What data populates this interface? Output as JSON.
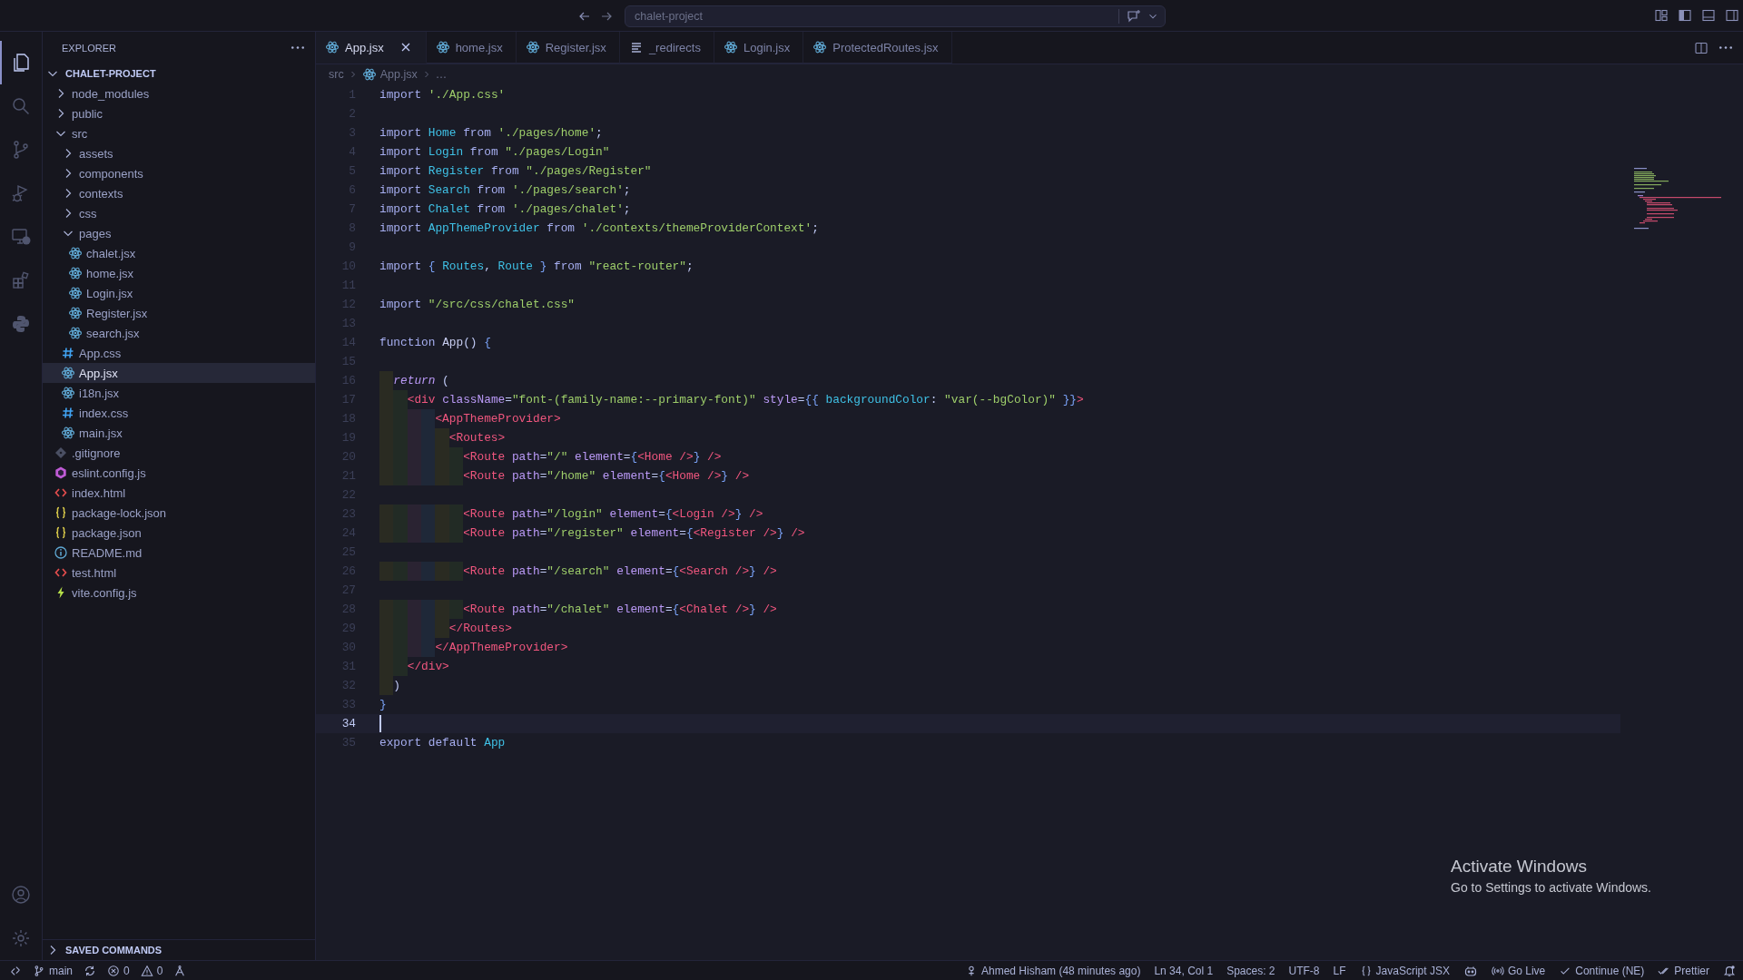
{
  "title_bar": {
    "search": "chalet-project"
  },
  "activity_bar": {
    "top": [
      {
        "kind": "files",
        "selected": true
      },
      {
        "kind": "search",
        "selected": false
      },
      {
        "kind": "source-control",
        "selected": false
      },
      {
        "kind": "run",
        "selected": false
      },
      {
        "kind": "remote",
        "selected": false
      },
      {
        "kind": "extensions",
        "selected": false
      },
      {
        "kind": "python",
        "selected": false
      }
    ],
    "bottom": [
      {
        "kind": "account"
      },
      {
        "kind": "settings"
      }
    ]
  },
  "explorer": {
    "title": "EXPLORER",
    "project": {
      "label": "CHALET-PROJECT",
      "expanded": true,
      "children": [
        {
          "label": "node_modules",
          "kind": "folder",
          "expanded": false,
          "selected": false
        },
        {
          "label": "public",
          "kind": "folder",
          "expanded": false,
          "selected": false
        },
        {
          "label": "src",
          "kind": "folder",
          "expanded": true,
          "selected": false,
          "children": [
            {
              "label": "assets",
              "kind": "folder",
              "expanded": false,
              "selected": false
            },
            {
              "label": "components",
              "kind": "folder",
              "expanded": false,
              "selected": false
            },
            {
              "label": "contexts",
              "kind": "folder",
              "expanded": false,
              "selected": false
            },
            {
              "label": "css",
              "kind": "folder",
              "expanded": false,
              "selected": false
            },
            {
              "label": "pages",
              "kind": "folder",
              "expanded": true,
              "selected": false,
              "children": [
                {
                  "label": "chalet.jsx",
                  "kind": "react",
                  "selected": false
                },
                {
                  "label": "home.jsx",
                  "kind": "react",
                  "selected": false
                },
                {
                  "label": "Login.jsx",
                  "kind": "react",
                  "selected": false
                },
                {
                  "label": "Register.jsx",
                  "kind": "react",
                  "selected": false
                },
                {
                  "label": "search.jsx",
                  "kind": "react",
                  "selected": false
                }
              ]
            },
            {
              "label": "App.css",
              "kind": "css",
              "selected": false
            },
            {
              "label": "App.jsx",
              "kind": "react",
              "selected": true
            },
            {
              "label": "i18n.jsx",
              "kind": "react",
              "selected": false
            },
            {
              "label": "index.css",
              "kind": "css",
              "selected": false
            },
            {
              "label": "main.jsx",
              "kind": "react",
              "selected": false
            }
          ]
        },
        {
          "label": ".gitignore",
          "kind": "git",
          "selected": false
        },
        {
          "label": "eslint.config.js",
          "kind": "eslint",
          "selected": false
        },
        {
          "label": "index.html",
          "kind": "html",
          "selected": false
        },
        {
          "label": "package-lock.json",
          "kind": "json",
          "selected": false
        },
        {
          "label": "package.json",
          "kind": "json",
          "selected": false
        },
        {
          "label": "README.md",
          "kind": "info",
          "selected": false
        },
        {
          "label": "test.html",
          "kind": "html",
          "selected": false
        },
        {
          "label": "vite.config.js",
          "kind": "vite",
          "selected": false
        }
      ]
    },
    "saved_commands": {
      "label": "SAVED COMMANDS",
      "expanded": false
    }
  },
  "tabs": [
    {
      "label": "App.jsx",
      "kind": "react",
      "selected": true
    },
    {
      "label": "home.jsx",
      "kind": "react",
      "selected": false
    },
    {
      "label": "Register.jsx",
      "kind": "react",
      "selected": false
    },
    {
      "label": "_redirects",
      "kind": "lines",
      "selected": false
    },
    {
      "label": "Login.jsx",
      "kind": "react",
      "selected": false
    },
    {
      "label": "ProtectedRoutes.jsx",
      "kind": "react",
      "selected": false
    }
  ],
  "breadcrumb": [
    {
      "label": "src",
      "kind": "folder"
    },
    {
      "label": "App.jsx",
      "kind": "react"
    },
    {
      "label": "…",
      "kind": "more"
    }
  ],
  "editor": {
    "lines": [
      {
        "number": "1",
        "selected": false,
        "tokens": [
          {
            "kind": "kw",
            "text": "import "
          },
          {
            "kind": "str",
            "text": "'./App.css'"
          }
        ]
      },
      {
        "number": "2",
        "selected": false
      },
      {
        "number": "3",
        "selected": false,
        "tokens": [
          {
            "kind": "kw",
            "text": "import "
          },
          {
            "kind": "id",
            "text": "Home "
          },
          {
            "kind": "kw",
            "text": "from "
          },
          {
            "kind": "str",
            "text": "'./pages/home'"
          },
          {
            "kind": "p",
            "text": ";"
          }
        ]
      },
      {
        "number": "4",
        "selected": false,
        "tokens": [
          {
            "kind": "kw",
            "text": "import "
          },
          {
            "kind": "id",
            "text": "Login "
          },
          {
            "kind": "kw",
            "text": "from "
          },
          {
            "kind": "str",
            "text": "\"./pages/Login\""
          }
        ]
      },
      {
        "number": "5",
        "selected": false,
        "tokens": [
          {
            "kind": "kw",
            "text": "import "
          },
          {
            "kind": "id",
            "text": "Register "
          },
          {
            "kind": "kw",
            "text": "from "
          },
          {
            "kind": "str",
            "text": "\"./pages/Register\""
          }
        ]
      },
      {
        "number": "6",
        "selected": false,
        "tokens": [
          {
            "kind": "kw",
            "text": "import "
          },
          {
            "kind": "id",
            "text": "Search "
          },
          {
            "kind": "kw",
            "text": "from "
          },
          {
            "kind": "str",
            "text": "'./pages/search'"
          },
          {
            "kind": "p",
            "text": ";"
          }
        ]
      },
      {
        "number": "7",
        "selected": false,
        "tokens": [
          {
            "kind": "kw",
            "text": "import "
          },
          {
            "kind": "id",
            "text": "Chalet "
          },
          {
            "kind": "kw",
            "text": "from "
          },
          {
            "kind": "str",
            "text": "'./pages/chalet'"
          },
          {
            "kind": "p",
            "text": ";"
          }
        ]
      },
      {
        "number": "8",
        "selected": false,
        "tokens": [
          {
            "kind": "kw",
            "text": "import "
          },
          {
            "kind": "id",
            "text": "AppThemeProvider "
          },
          {
            "kind": "kw",
            "text": "from "
          },
          {
            "kind": "str",
            "text": "'./contexts/themeProviderContext'"
          },
          {
            "kind": "p",
            "text": ";"
          }
        ]
      },
      {
        "number": "9",
        "selected": false
      },
      {
        "number": "10",
        "selected": false,
        "tokens": [
          {
            "kind": "kw",
            "text": "import "
          },
          {
            "kind": "br",
            "text": "{ "
          },
          {
            "kind": "id",
            "text": "Routes"
          },
          {
            "kind": "p",
            "text": ", "
          },
          {
            "kind": "id",
            "text": "Route "
          },
          {
            "kind": "br",
            "text": "} "
          },
          {
            "kind": "kw",
            "text": "from "
          },
          {
            "kind": "str",
            "text": "\"react-router\""
          },
          {
            "kind": "p",
            "text": ";"
          }
        ]
      },
      {
        "number": "11",
        "selected": false
      },
      {
        "number": "12",
        "selected": false,
        "tokens": [
          {
            "kind": "kw",
            "text": "import "
          },
          {
            "kind": "str",
            "text": "\"/src/css/chalet.css\""
          }
        ]
      },
      {
        "number": "13",
        "selected": false
      },
      {
        "number": "14",
        "selected": false,
        "tokens": [
          {
            "kind": "kw",
            "text": "function "
          },
          {
            "kind": "fn",
            "text": "App"
          },
          {
            "kind": "p",
            "text": "() "
          },
          {
            "kind": "br",
            "text": "{"
          }
        ]
      },
      {
        "number": "15",
        "selected": false
      },
      {
        "number": "16",
        "selected": false,
        "tokens": [
          {
            "kind": "ret",
            "text": "  return"
          },
          {
            "kind": "p",
            "text": " ("
          }
        ]
      },
      {
        "number": "17",
        "selected": false,
        "tokens": [
          {
            "kind": "tag",
            "text": "    <div "
          },
          {
            "kind": "attr",
            "text": "className"
          },
          {
            "kind": "p",
            "text": "="
          },
          {
            "kind": "str",
            "text": "\"font-(family-name:--primary-font)\""
          },
          {
            "kind": "attr",
            "text": " style"
          },
          {
            "kind": "p",
            "text": "="
          },
          {
            "kind": "br",
            "text": "{{ "
          },
          {
            "kind": "id",
            "text": "backgroundColor"
          },
          {
            "kind": "p",
            "text": ": "
          },
          {
            "kind": "str",
            "text": "\"var(--bgColor)\""
          },
          {
            "kind": "br",
            "text": " }}"
          },
          {
            "kind": "tag",
            "text": ">"
          }
        ]
      },
      {
        "number": "18",
        "selected": false,
        "tokens": [
          {
            "kind": "tag",
            "text": "        <AppThemeProvider>"
          }
        ]
      },
      {
        "number": "19",
        "selected": false,
        "tokens": [
          {
            "kind": "tag",
            "text": "          <Routes>"
          }
        ]
      },
      {
        "number": "20",
        "selected": false,
        "tokens": [
          {
            "kind": "tag",
            "text": "            <Route "
          },
          {
            "kind": "attr",
            "text": "path"
          },
          {
            "kind": "p",
            "text": "="
          },
          {
            "kind": "str",
            "text": "\"/\""
          },
          {
            "kind": "attr",
            "text": " element"
          },
          {
            "kind": "p",
            "text": "="
          },
          {
            "kind": "br",
            "text": "{"
          },
          {
            "kind": "tag",
            "text": "<Home />"
          },
          {
            "kind": "br",
            "text": "}"
          },
          {
            "kind": "tag",
            "text": " />"
          }
        ]
      },
      {
        "number": "21",
        "selected": false,
        "tokens": [
          {
            "kind": "tag",
            "text": "            <Route "
          },
          {
            "kind": "attr",
            "text": "path"
          },
          {
            "kind": "p",
            "text": "="
          },
          {
            "kind": "str",
            "text": "\"/home\""
          },
          {
            "kind": "attr",
            "text": " element"
          },
          {
            "kind": "p",
            "text": "="
          },
          {
            "kind": "br",
            "text": "{"
          },
          {
            "kind": "tag",
            "text": "<Home />"
          },
          {
            "kind": "br",
            "text": "}"
          },
          {
            "kind": "tag",
            "text": " />"
          }
        ]
      },
      {
        "number": "22",
        "selected": false
      },
      {
        "number": "23",
        "selected": false,
        "tokens": [
          {
            "kind": "tag",
            "text": "            <Route "
          },
          {
            "kind": "attr",
            "text": "path"
          },
          {
            "kind": "p",
            "text": "="
          },
          {
            "kind": "str",
            "text": "\"/login\""
          },
          {
            "kind": "attr",
            "text": " element"
          },
          {
            "kind": "p",
            "text": "="
          },
          {
            "kind": "br",
            "text": "{"
          },
          {
            "kind": "tag",
            "text": "<Login />"
          },
          {
            "kind": "br",
            "text": "}"
          },
          {
            "kind": "tag",
            "text": " />"
          }
        ]
      },
      {
        "number": "24",
        "selected": false,
        "tokens": [
          {
            "kind": "tag",
            "text": "            <Route "
          },
          {
            "kind": "attr",
            "text": "path"
          },
          {
            "kind": "p",
            "text": "="
          },
          {
            "kind": "str",
            "text": "\"/register\""
          },
          {
            "kind": "attr",
            "text": " element"
          },
          {
            "kind": "p",
            "text": "="
          },
          {
            "kind": "br",
            "text": "{"
          },
          {
            "kind": "tag",
            "text": "<Register />"
          },
          {
            "kind": "br",
            "text": "}"
          },
          {
            "kind": "tag",
            "text": " />"
          }
        ]
      },
      {
        "number": "25",
        "selected": false
      },
      {
        "number": "26",
        "selected": false,
        "tokens": [
          {
            "kind": "tag",
            "text": "            <Route "
          },
          {
            "kind": "attr",
            "text": "path"
          },
          {
            "kind": "p",
            "text": "="
          },
          {
            "kind": "str",
            "text": "\"/search\""
          },
          {
            "kind": "attr",
            "text": " element"
          },
          {
            "kind": "p",
            "text": "="
          },
          {
            "kind": "br",
            "text": "{"
          },
          {
            "kind": "tag",
            "text": "<Search />"
          },
          {
            "kind": "br",
            "text": "}"
          },
          {
            "kind": "tag",
            "text": " />"
          }
        ]
      },
      {
        "number": "27",
        "selected": false
      },
      {
        "number": "28",
        "selected": false,
        "tokens": [
          {
            "kind": "tag",
            "text": "            <Route "
          },
          {
            "kind": "attr",
            "text": "path"
          },
          {
            "kind": "p",
            "text": "="
          },
          {
            "kind": "str",
            "text": "\"/chalet\""
          },
          {
            "kind": "attr",
            "text": " element"
          },
          {
            "kind": "p",
            "text": "="
          },
          {
            "kind": "br",
            "text": "{"
          },
          {
            "kind": "tag",
            "text": "<Chalet />"
          },
          {
            "kind": "br",
            "text": "}"
          },
          {
            "kind": "tag",
            "text": " />"
          }
        ]
      },
      {
        "number": "29",
        "selected": false,
        "tokens": [
          {
            "kind": "tag",
            "text": "          </Routes>"
          }
        ]
      },
      {
        "number": "30",
        "selected": false,
        "tokens": [
          {
            "kind": "tag",
            "text": "        </AppThemeProvider>"
          }
        ]
      },
      {
        "number": "31",
        "selected": false,
        "tokens": [
          {
            "kind": "tag",
            "text": "    </div>"
          }
        ]
      },
      {
        "number": "32",
        "selected": false,
        "tokens": [
          {
            "kind": "p",
            "text": "  )"
          }
        ]
      },
      {
        "number": "33",
        "selected": false,
        "tokens": [
          {
            "kind": "br",
            "text": "}"
          }
        ]
      },
      {
        "number": "34",
        "selected": true
      },
      {
        "number": "35",
        "selected": false,
        "tokens": [
          {
            "kind": "kw",
            "text": "export default "
          },
          {
            "kind": "id",
            "text": "App"
          }
        ]
      }
    ]
  },
  "status_bar": {
    "left": [
      {
        "kind": "remote"
      },
      {
        "kind": "branch",
        "text": "main"
      },
      {
        "kind": "sync"
      },
      {
        "kind": "errors",
        "text": "0"
      },
      {
        "kind": "warnings",
        "text": "0"
      },
      {
        "kind": "ports"
      }
    ],
    "right": [
      {
        "kind": "blame",
        "text": "Ahmed Hisham (48 minutes ago)"
      },
      {
        "kind": "plain",
        "text": "Ln 34, Col 1"
      },
      {
        "kind": "plain",
        "text": "Spaces: 2"
      },
      {
        "kind": "plain",
        "text": "UTF-8"
      },
      {
        "kind": "plain",
        "text": "LF"
      },
      {
        "kind": "language",
        "text": "JavaScript JSX"
      },
      {
        "kind": "copilot"
      },
      {
        "kind": "broadcast",
        "text": "Go Live"
      },
      {
        "kind": "check",
        "text": "Continue (NE)"
      },
      {
        "kind": "double-check",
        "text": "Prettier"
      },
      {
        "kind": "bell"
      }
    ]
  },
  "os_notice": {
    "title": "Activate Windows",
    "text": "Go to Settings to activate Windows."
  }
}
